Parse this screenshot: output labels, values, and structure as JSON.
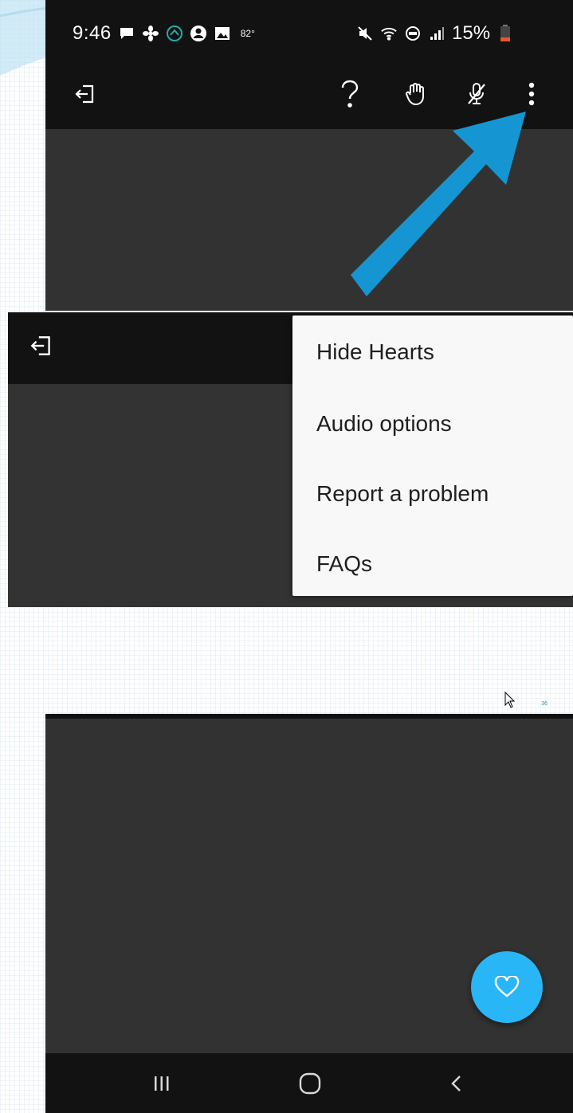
{
  "status_bar": {
    "time": "9:46",
    "temperature": "82°",
    "battery_percent": "15%",
    "left_icons": [
      "message-icon",
      "fan-icon",
      "circle-app-icon",
      "account-icon",
      "gallery-icon"
    ],
    "right_icons": [
      "mute-icon",
      "wifi-icon",
      "volte-icon",
      "signal-icon",
      "battery-icon"
    ],
    "battery_color": "#e8572a"
  },
  "app_bar": {
    "icons": [
      "exit-icon",
      "help-icon",
      "raise-hand-icon",
      "mic-off-icon",
      "more-vert-icon"
    ]
  },
  "annotation": {
    "arrow_color": "#1596d3",
    "points_to": "more-vert-icon"
  },
  "overflow_menu": {
    "items": [
      "Hide Hearts",
      "Audio options",
      "Report a problem",
      "FAQs"
    ]
  },
  "slide": {
    "page_number": "36"
  },
  "fab": {
    "icon": "heart-icon",
    "color": "#29b6f6"
  },
  "nav_bar": {
    "icons": [
      "recents-icon",
      "home-icon",
      "back-icon"
    ]
  }
}
